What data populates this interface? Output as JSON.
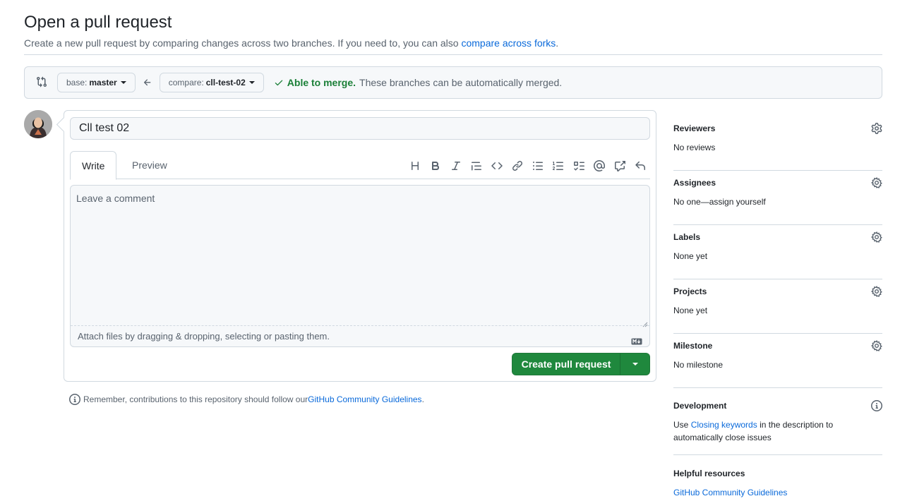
{
  "header": {
    "title": "Open a pull request",
    "subtitle_prefix": "Create a new pull request by comparing changes across two branches. If you need to, you can also ",
    "subtitle_link": "compare across forks",
    "subtitle_suffix": "."
  },
  "compare": {
    "base_label": "base:",
    "base_branch": "master",
    "compare_label": "compare:",
    "compare_branch": "cll-test-02",
    "merge_ok": "Able to merge.",
    "merge_text": "These branches can be automatically merged."
  },
  "form": {
    "title_value": "Cll test 02",
    "tab_write": "Write",
    "tab_preview": "Preview",
    "comment_placeholder": "Leave a comment",
    "attach_text": "Attach files by dragging & dropping, selecting or pasting them.",
    "create_button": "Create pull request"
  },
  "note": {
    "text_prefix": "Remember, contributions to this repository should follow our ",
    "link": "GitHub Community Guidelines",
    "text_suffix": "."
  },
  "sidebar": {
    "reviewers": {
      "title": "Reviewers",
      "value": "No reviews"
    },
    "assignees": {
      "title": "Assignees",
      "value": "No one—assign yourself"
    },
    "labels": {
      "title": "Labels",
      "value": "None yet"
    },
    "projects": {
      "title": "Projects",
      "value": "None yet"
    },
    "milestone": {
      "title": "Milestone",
      "value": "No milestone"
    },
    "development": {
      "title": "Development",
      "prefix": "Use ",
      "link": "Closing keywords",
      "suffix": " in the description to automatically close issues"
    },
    "resources": {
      "title": "Helpful resources",
      "link": "GitHub Community Guidelines"
    }
  },
  "colors": {
    "accent": "#0969da",
    "success": "#1a7f37",
    "button": "#1f883d"
  }
}
